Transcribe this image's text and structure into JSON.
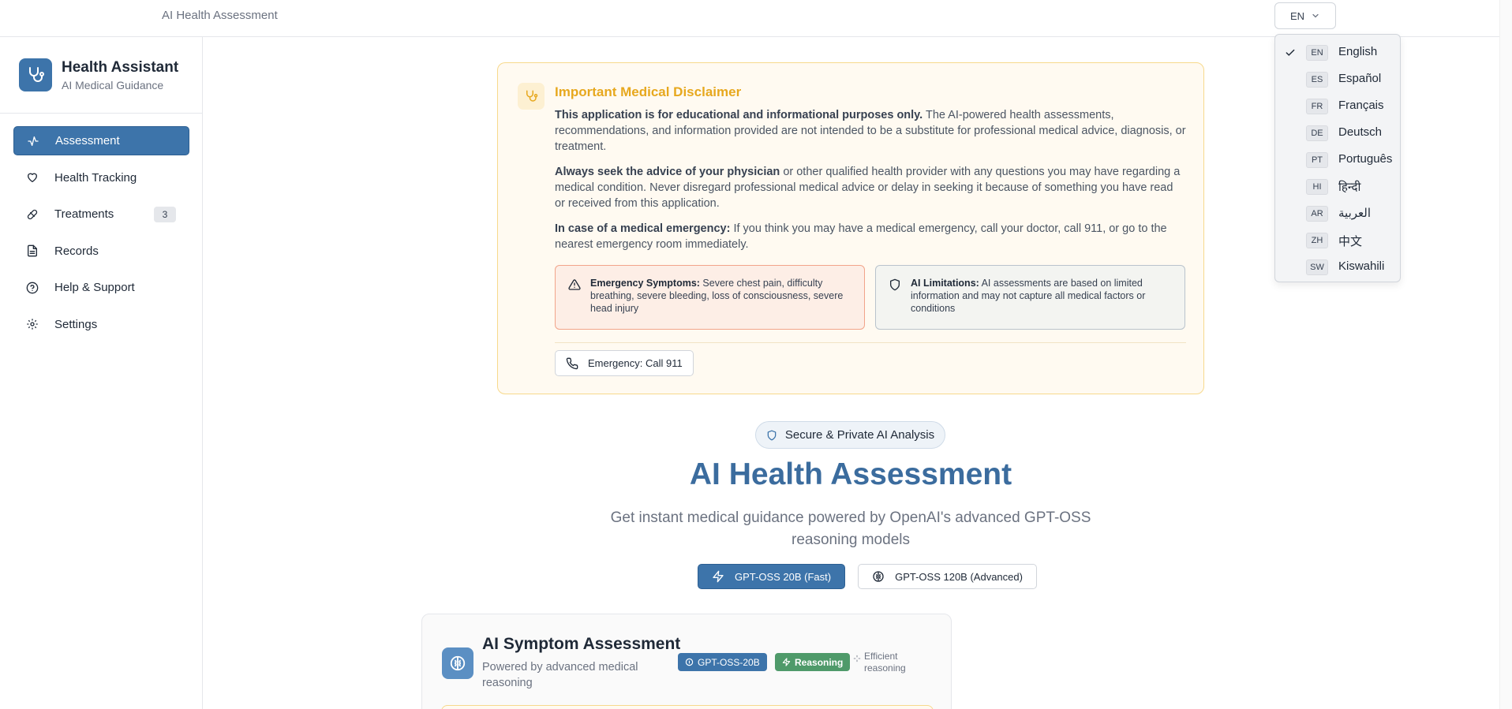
{
  "topbar": {
    "title": "AI Health Assessment",
    "language_button": "EN"
  },
  "brand": {
    "name": "Health Assistant",
    "subtitle": "AI Medical Guidance"
  },
  "sidebar": {
    "items": [
      {
        "label": "Assessment",
        "icon": "activity-icon",
        "active": true
      },
      {
        "label": "Health Tracking",
        "icon": "heart-icon"
      },
      {
        "label": "Treatments",
        "icon": "pill-icon",
        "badge": "3"
      },
      {
        "label": "Records",
        "icon": "file-text-icon"
      },
      {
        "label": "Help & Support",
        "icon": "help-circle-icon"
      },
      {
        "label": "Settings",
        "icon": "gear-icon"
      }
    ]
  },
  "disclaimer": {
    "title": "Important Medical Disclaimer",
    "p1_bold": "This application is for educational and informational purposes only.",
    "p1_rest": " The AI-powered health assessments, recommendations, and information provided are not intended to be a substitute for professional medical advice, diagnosis, or treatment.",
    "p2_bold": "Always seek the advice of your physician",
    "p2_rest": " or other qualified health provider with any questions you may have regarding a medical condition. Never disregard professional medical advice or delay in seeking it because of something you have read or received from this application.",
    "p3_bold": "In case of a medical emergency:",
    "p3_rest": " If you think you may have a medical emergency, call your doctor, call 911, or go to the nearest emergency room immediately.",
    "emergency_bold": "Emergency Symptoms:",
    "emergency_rest": " Severe chest pain, difficulty breathing, severe bleeding, loss of consciousness, severe head injury",
    "ai_bold": "AI Limitations:",
    "ai_rest": " AI assessments are based on limited information and may not capture all medical factors or conditions",
    "call_button": "Emergency: Call 911"
  },
  "hero": {
    "pill": "Secure & Private AI Analysis",
    "title": "AI Health Assessment",
    "subtitle": "Get instant medical guidance powered by OpenAI's advanced GPT-OSS reasoning models",
    "models": [
      {
        "label": "GPT-OSS 20B (Fast)",
        "active": true
      },
      {
        "label": "GPT-OSS 120B (Advanced)",
        "active": false
      }
    ]
  },
  "symptom_card": {
    "title": "AI Symptom Assessment",
    "subtitle": "Powered by advanced medical reasoning",
    "badge_model": "GPT-OSS-20B",
    "badge_reasoning": "Reasoning",
    "efficient": "Efficient reasoning"
  },
  "language_menu": {
    "selected": "EN",
    "options": [
      {
        "code": "EN",
        "name": "English"
      },
      {
        "code": "ES",
        "name": "Español"
      },
      {
        "code": "FR",
        "name": "Français"
      },
      {
        "code": "DE",
        "name": "Deutsch"
      },
      {
        "code": "PT",
        "name": "Português"
      },
      {
        "code": "HI",
        "name": "हिन्दी"
      },
      {
        "code": "AR",
        "name": "العربية"
      },
      {
        "code": "ZH",
        "name": "中文"
      },
      {
        "code": "SW",
        "name": "Kiswahili"
      }
    ]
  },
  "colors": {
    "primary": "#3d74aa",
    "warning": "#e7a81e",
    "success": "#4f9a6a"
  }
}
